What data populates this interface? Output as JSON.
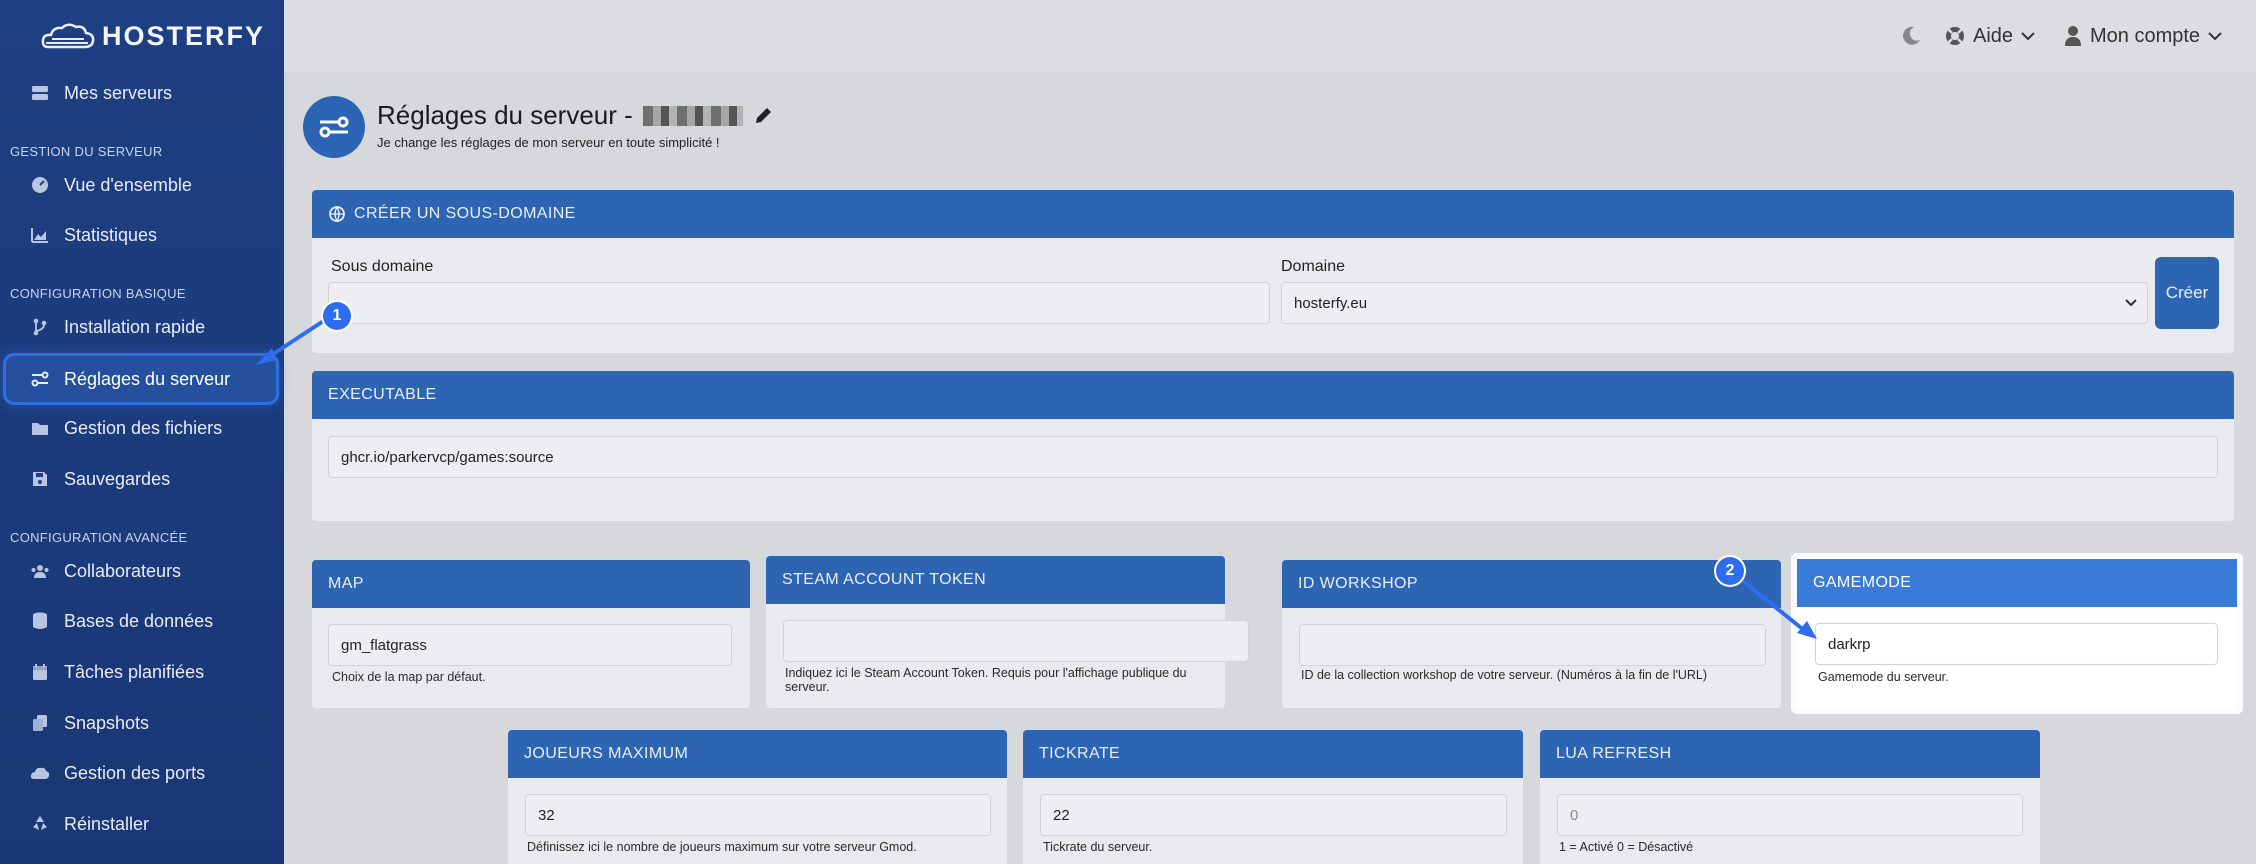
{
  "brand": {
    "name": "HOSTERFY"
  },
  "sidebar": {
    "top_item": {
      "label": "Mes serveurs",
      "icon": "server-icon"
    },
    "sections": [
      {
        "title": "GESTION DU SERVEUR",
        "items": [
          {
            "label": "Vue d'ensemble",
            "icon": "gauge-icon"
          },
          {
            "label": "Statistiques",
            "icon": "chart-icon"
          }
        ]
      },
      {
        "title": "CONFIGURATION BASIQUE",
        "items": [
          {
            "label": "Installation rapide",
            "icon": "branch-icon"
          },
          {
            "label": "Réglages du serveur",
            "icon": "settings-key-icon",
            "active": true
          },
          {
            "label": "Gestion des fichiers",
            "icon": "folder-icon"
          },
          {
            "label": "Sauvegardes",
            "icon": "save-icon"
          }
        ]
      },
      {
        "title": "CONFIGURATION AVANCÉE",
        "items": [
          {
            "label": "Collaborateurs",
            "icon": "users-icon"
          },
          {
            "label": "Bases de données",
            "icon": "database-icon"
          },
          {
            "label": "Tâches planifiées",
            "icon": "calendar-icon"
          },
          {
            "label": "Snapshots",
            "icon": "copy-icon"
          },
          {
            "label": "Gestion des ports",
            "icon": "cloud-icon"
          },
          {
            "label": "Réinstaller",
            "icon": "recycle-icon"
          }
        ]
      }
    ]
  },
  "topbar": {
    "theme_icon": "moon-icon",
    "help_label": "Aide",
    "account_label": "Mon compte"
  },
  "page": {
    "title": "Réglages du serveur -",
    "subtitle": "Je change les réglages de mon serveur en toute simplicité !"
  },
  "subdomain": {
    "header": "CRÉER UN SOUS-DOMAINE",
    "sub_label": "Sous domaine",
    "sub_value": "",
    "domain_label": "Domaine",
    "domain_value": "hosterfy.eu",
    "create_label": "Créer"
  },
  "executable": {
    "header": "EXECUTABLE",
    "value": "ghcr.io/parkervcp/games:source"
  },
  "fields": {
    "map": {
      "header": "MAP",
      "value": "gm_flatgrass",
      "help": "Choix de la map par défaut."
    },
    "steam": {
      "header": "STEAM ACCOUNT TOKEN",
      "value": "",
      "help": "Indiquez ici le Steam Account Token. Requis pour l'affichage publique du serveur."
    },
    "workshop": {
      "header": "ID WORKSHOP",
      "value": "",
      "help": "ID de la collection workshop de votre serveur. (Numéros à la fin de l'URL)"
    },
    "gamemode": {
      "header": "GAMEMODE",
      "value": "darkrp",
      "help": "Gamemode du serveur."
    },
    "players": {
      "header": "JOUEURS MAXIMUM",
      "value": "32",
      "help": "Définissez ici le nombre de joueurs maximum sur votre serveur Gmod."
    },
    "tickrate": {
      "header": "TICKRATE",
      "value": "22",
      "help": "Tickrate du serveur."
    },
    "lua": {
      "header": "LUA REFRESH",
      "value": "0",
      "help": "1 = Activé 0 = Désactivé"
    }
  },
  "annotations": {
    "badge1": "1",
    "badge2": "2"
  }
}
